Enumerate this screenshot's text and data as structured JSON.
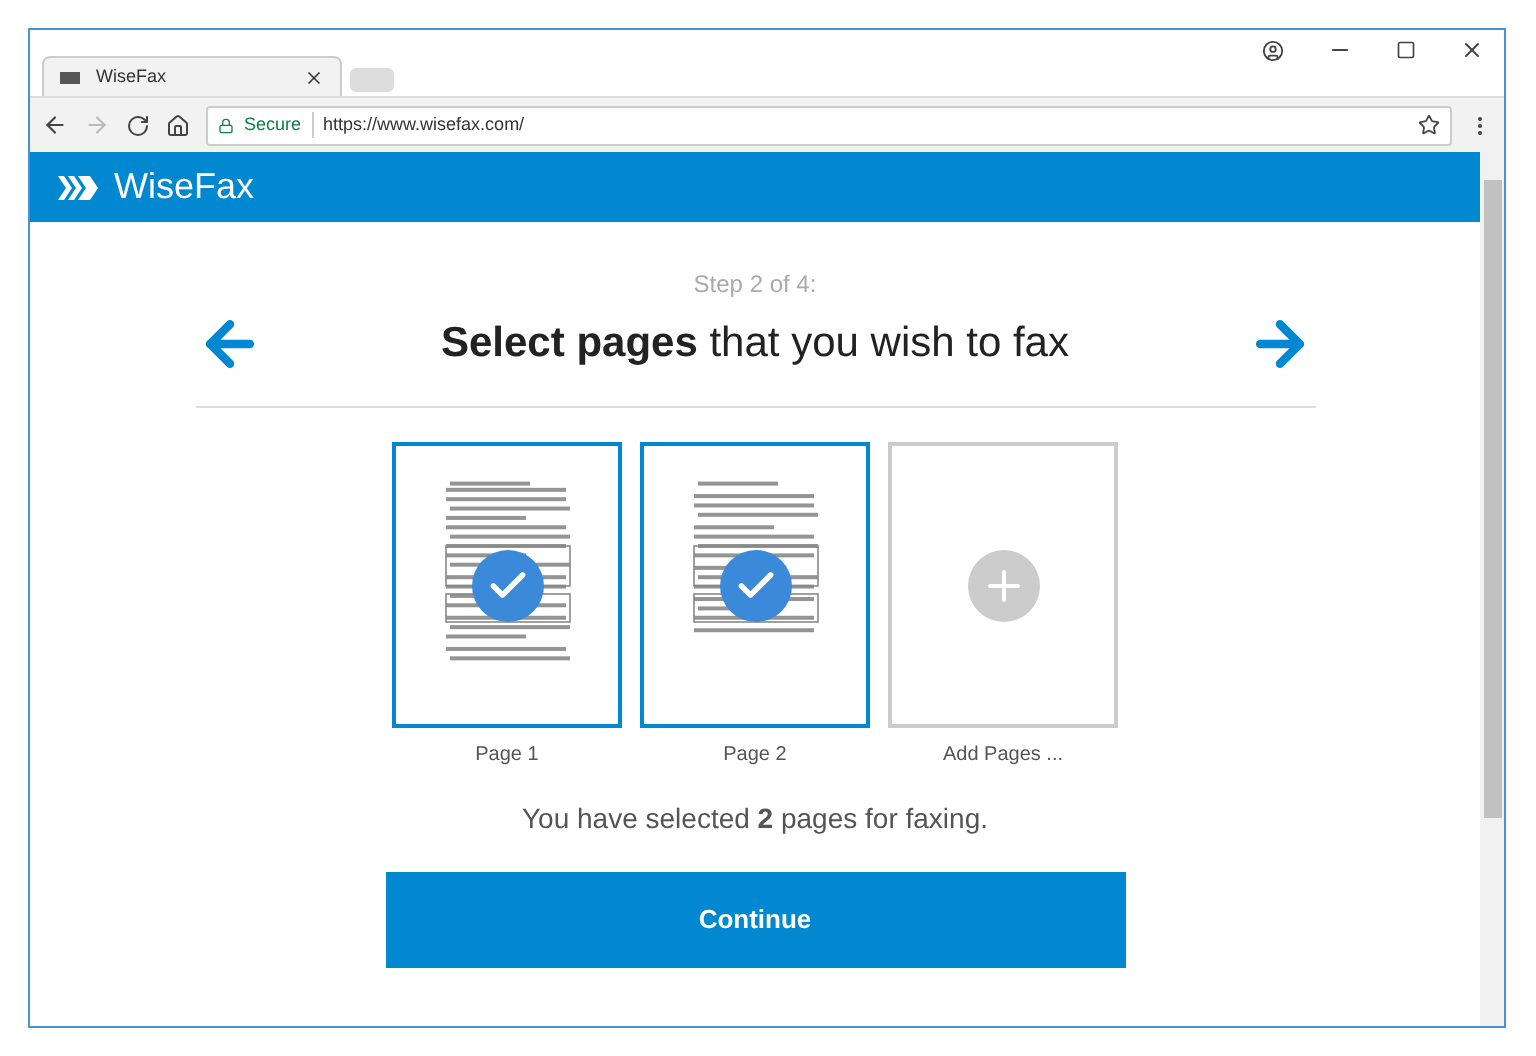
{
  "browser": {
    "tab_title": "WiseFax",
    "security": "Secure",
    "url": "https://www.wisefax.com/"
  },
  "header": {
    "brand": "WiseFax"
  },
  "step": "Step 2 of 4:",
  "heading": "**Select pages** that you wish to fax",
  "pages": [
    {
      "label": "Page 1",
      "selected": true
    },
    {
      "label": "Page 2",
      "selected": true
    }
  ],
  "add_label": "Add Pages ...",
  "summary": "You have selected **2** pages for faxing.",
  "continue_button": "Continue"
}
